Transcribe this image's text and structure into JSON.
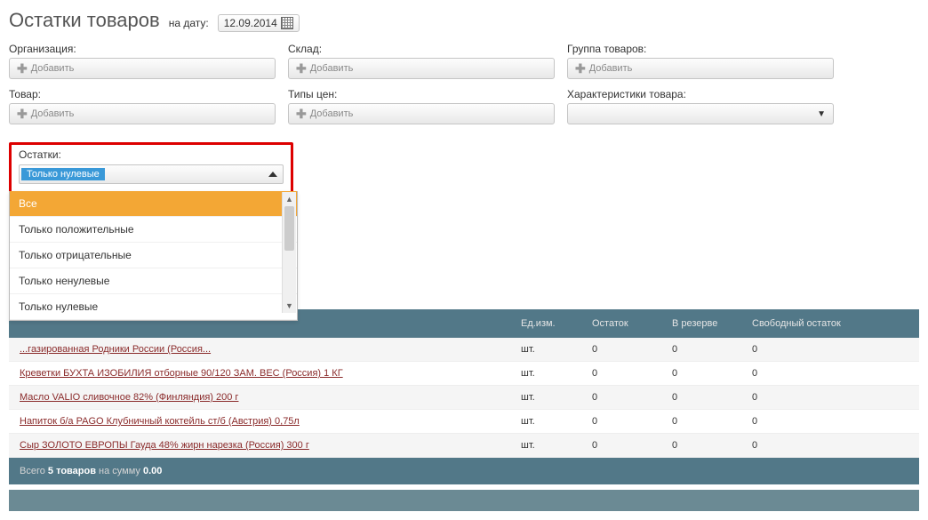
{
  "header": {
    "title": "Остатки товаров",
    "date_label": "на дату:",
    "date_value": "12.09.2014"
  },
  "filters": {
    "org": {
      "label": "Организация:",
      "add": "Добавить"
    },
    "warehouse": {
      "label": "Склад:",
      "add": "Добавить"
    },
    "group": {
      "label": "Группа товаров:",
      "add": "Добавить"
    },
    "product": {
      "label": "Товар:",
      "add": "Добавить"
    },
    "price_types": {
      "label": "Типы цен:",
      "add": "Добавить"
    },
    "characteristics": {
      "label": "Характеристики товара:",
      "placeholder": ""
    },
    "stock": {
      "label": "Остатки:",
      "selected": "Только нулевые",
      "options": [
        "Все",
        "Только положительные",
        "Только отрицательные",
        "Только ненулевые",
        "Только нулевые"
      ]
    }
  },
  "table": {
    "headers": {
      "unit": "Ед.изм.",
      "stock": "Остаток",
      "reserve": "В резерве",
      "free": "Свободный остаток"
    },
    "rows": [
      {
        "name": "...газированная Родники России (Россия...",
        "unit": "шт.",
        "stock": "0",
        "reserve": "0",
        "free": "0"
      },
      {
        "name": "Креветки БУХТА ИЗОБИЛИЯ отборные 90/120 ЗАМ. ВЕС (Россия) 1 КГ",
        "unit": "шт.",
        "stock": "0",
        "reserve": "0",
        "free": "0"
      },
      {
        "name": "Масло VALIO сливочное 82% (Финляндия) 200 г",
        "unit": "шт.",
        "stock": "0",
        "reserve": "0",
        "free": "0"
      },
      {
        "name": "Напиток б/а PAGO Клубничный коктейль ст/б (Австрия) 0,75л",
        "unit": "шт.",
        "stock": "0",
        "reserve": "0",
        "free": "0"
      },
      {
        "name": "Сыр ЗОЛОТО ЕВРОПЫ Гауда 48% жирн нарезка (Россия) 300 г",
        "unit": "шт.",
        "stock": "0",
        "reserve": "0",
        "free": "0"
      }
    ]
  },
  "footer": {
    "prefix": "Всего",
    "count": "5 товаров",
    "mid": "на сумму",
    "sum": "0.00"
  }
}
